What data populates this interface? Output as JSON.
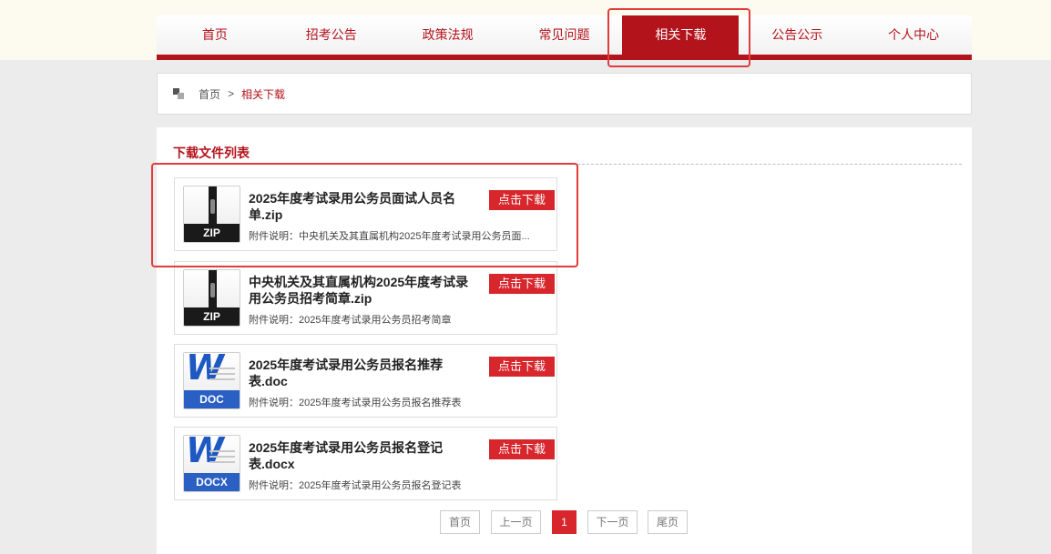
{
  "nav": {
    "items": [
      {
        "label": "首页"
      },
      {
        "label": "招考公告"
      },
      {
        "label": "政策法规"
      },
      {
        "label": "常见问题"
      },
      {
        "label": "相关下载"
      },
      {
        "label": "公告公示"
      },
      {
        "label": "个人中心"
      }
    ],
    "active": "相关下载"
  },
  "breadcrumb": {
    "home": "首页",
    "separator": ">",
    "current": "相关下载"
  },
  "list_title": "下载文件列表",
  "files": [
    {
      "icon": "zip-file-icon",
      "type_label": "ZIP",
      "name": "2025年度考试录用公务员面试人员名单.zip",
      "desc": "附件说明：中央机关及其直属机构2025年度考试录用公务员面...",
      "button": "点击下载"
    },
    {
      "icon": "zip-file-icon",
      "type_label": "ZIP",
      "name": "中央机关及其直属机构2025年度考试录用公务员招考简章.zip",
      "desc": "附件说明：2025年度考试录用公务员招考简章",
      "button": "点击下载"
    },
    {
      "icon": "word-file-icon",
      "type_label": "DOC",
      "name": "2025年度考试录用公务员报名推荐表.doc",
      "desc": "附件说明：2025年度考试录用公务员报名推荐表",
      "button": "点击下载"
    },
    {
      "icon": "word-file-icon",
      "type_label": "DOCX",
      "name": "2025年度考试录用公务员报名登记表.docx",
      "desc": "附件说明：2025年度考试录用公务员报名登记表",
      "button": "点击下载"
    }
  ],
  "pagination": {
    "first": "首页",
    "prev": "上一页",
    "current": "1",
    "next": "下一页",
    "last": "尾页"
  },
  "colors": {
    "accent": "#b3131b",
    "button": "#d7262c",
    "highlight": "#e23b3b"
  }
}
